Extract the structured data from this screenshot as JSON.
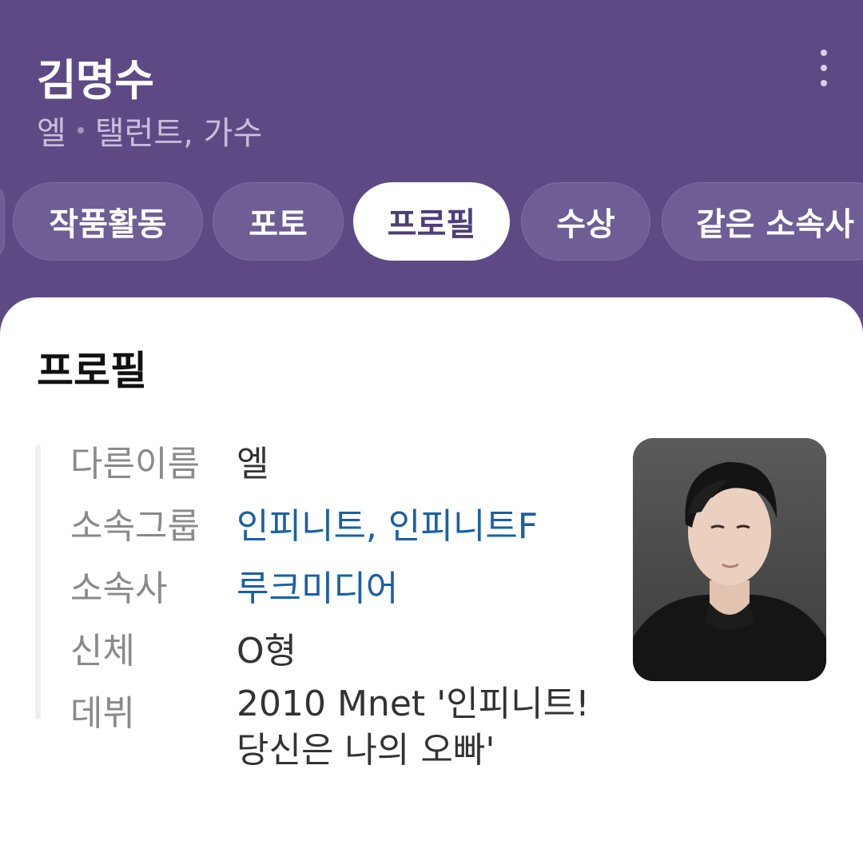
{
  "header": {
    "name": "김명수",
    "subtitle_alias": "엘",
    "subtitle_roles": "탤런트, 가수"
  },
  "tabs": [
    {
      "label": "작품활동",
      "active": false
    },
    {
      "label": "포토",
      "active": false
    },
    {
      "label": "프로필",
      "active": true
    },
    {
      "label": "수상",
      "active": false
    },
    {
      "label": "같은 소속사",
      "active": false
    }
  ],
  "profile": {
    "section_title": "프로필",
    "rows": [
      {
        "label": "다른이름",
        "value": "엘",
        "link": false
      },
      {
        "label": "소속그룹",
        "value": "인피니트, 인피니트F",
        "link": true
      },
      {
        "label": "소속사",
        "value": "루크미디어",
        "link": true
      },
      {
        "label": "신체",
        "value": "O형",
        "link": false
      },
      {
        "label": "데뷔",
        "value": "2010 Mnet '인피니트! 당신은 나의 오빠'",
        "link": false
      }
    ]
  },
  "colors": {
    "header_bg": "#5d4a85",
    "tab_bg": "#6f5d96",
    "active_tab_text": "#4d3d7a",
    "link": "#1a5fa8"
  },
  "icons": {
    "more": "more-vertical-icon"
  }
}
